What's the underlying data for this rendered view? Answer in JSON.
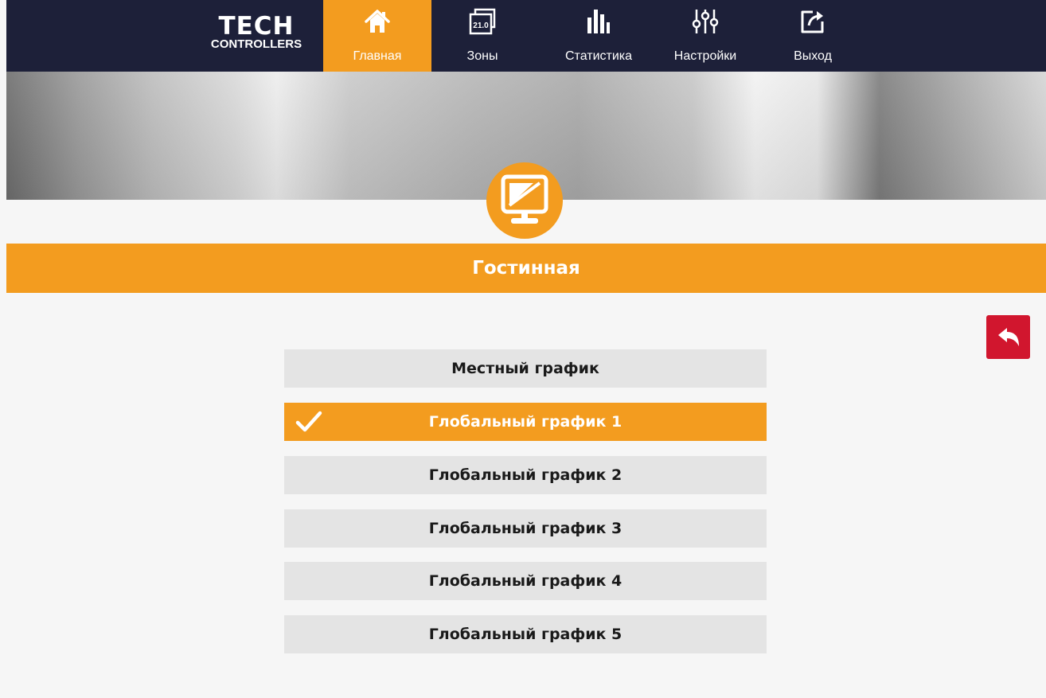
{
  "brand": {
    "line1": "TECH",
    "line2": "CONTROLLERS"
  },
  "nav": [
    {
      "label": "Главная",
      "icon": "home-icon",
      "active": true
    },
    {
      "label": "Зоны",
      "icon": "zones-icon",
      "badge": "21.0"
    },
    {
      "label": "Статистика",
      "icon": "statistics-icon"
    },
    {
      "label": "Настройки",
      "icon": "settings-sliders-icon"
    },
    {
      "label": "Выход",
      "icon": "logout-icon"
    }
  ],
  "zone": {
    "title": "Гостинная",
    "icon": "monitor-icon"
  },
  "back_icon": "back-arrow-icon",
  "options": [
    {
      "label": "Местный график",
      "selected": false
    },
    {
      "label": "Глобальный график 1",
      "selected": true
    },
    {
      "label": "Глобальный график 2",
      "selected": false
    },
    {
      "label": "Глобальный график 3",
      "selected": false
    },
    {
      "label": "Глобальный график 4",
      "selected": false
    },
    {
      "label": "Глобальный график 5",
      "selected": false
    }
  ],
  "colors": {
    "accent": "#f39c1f",
    "nav_bg": "#1d2039",
    "back": "#d1162e",
    "option_bg": "#e4e4e4"
  }
}
